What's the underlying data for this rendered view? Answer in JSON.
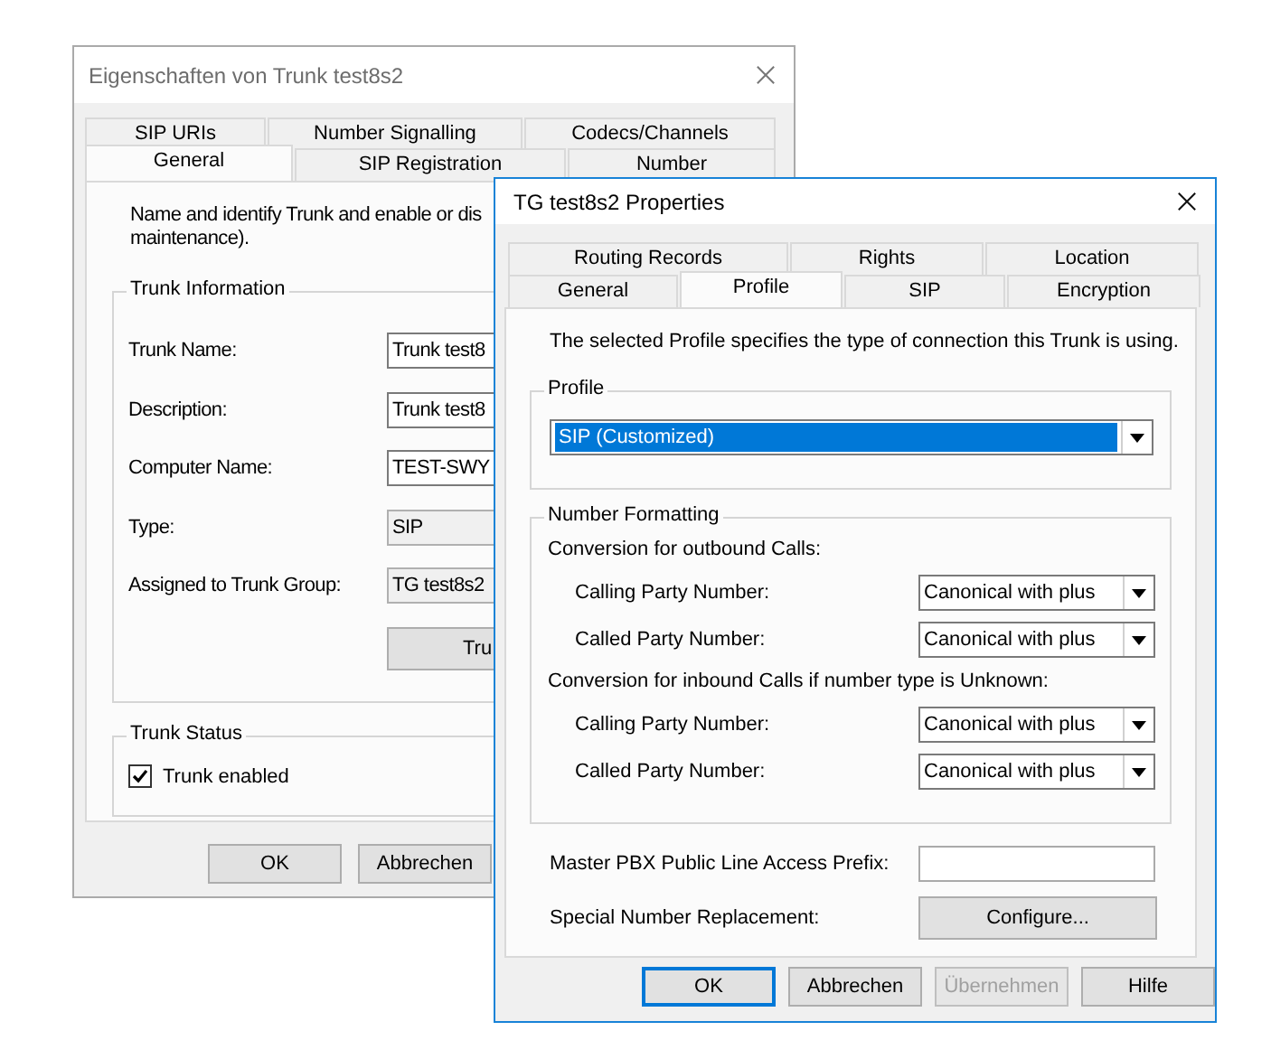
{
  "back_window": {
    "title": "Eigenschaften von Trunk test8s2",
    "tab_rows": [
      [
        {
          "label": "SIP URIs",
          "selected": false
        },
        {
          "label": "Number Signalling",
          "selected": false
        },
        {
          "label": "Codecs/Channels",
          "selected": false
        }
      ],
      [
        {
          "label": "General",
          "selected": true
        },
        {
          "label": "SIP Registration",
          "selected": false
        },
        {
          "label": "Number",
          "selected": false
        }
      ]
    ],
    "description": [
      "Name and identify Trunk and enable or dis",
      "maintenance)."
    ],
    "trunk_information": {
      "title": "Trunk Information",
      "fields": [
        {
          "label": "Trunk Name:",
          "value": "Trunk test8",
          "readonly": false
        },
        {
          "label": "Description:",
          "value": "Trunk test8",
          "readonly": false
        },
        {
          "label": "Computer Name:",
          "value": "TEST-SWY",
          "readonly": false
        },
        {
          "label": "Type:",
          "value": "SIP",
          "readonly": true
        },
        {
          "label": "Assigned to Trunk Group:",
          "value": "TG test8s2",
          "readonly": true
        }
      ],
      "button": "Tru"
    },
    "trunk_status": {
      "title": "Trunk Status",
      "checkbox": {
        "label": "Trunk enabled",
        "checked": true
      }
    },
    "buttons": [
      {
        "label": "OK",
        "disabled": false
      },
      {
        "label": "Abbrechen",
        "disabled": false
      }
    ]
  },
  "front_window": {
    "title": "TG test8s2 Properties",
    "tab_rows": [
      [
        {
          "label": "Routing Records",
          "selected": false
        },
        {
          "label": "Rights",
          "selected": false
        },
        {
          "label": "Location",
          "selected": false
        }
      ],
      [
        {
          "label": "General",
          "selected": false
        },
        {
          "label": "Profile",
          "selected": true
        },
        {
          "label": "SIP",
          "selected": false
        },
        {
          "label": "Encryption",
          "selected": false
        }
      ]
    ],
    "description": "The selected Profile specifies the type of connection this Trunk is using.",
    "profile": {
      "title": "Profile",
      "value": "SIP (Customized)",
      "selected": true
    },
    "number_formatting": {
      "title": "Number Formatting",
      "sections": [
        {
          "heading": "Conversion for outbound Calls:",
          "rows": [
            {
              "label": "Calling Party Number:",
              "value": "Canonical with plus"
            },
            {
              "label": "Called Party Number:",
              "value": "Canonical with plus"
            }
          ]
        },
        {
          "heading": "Conversion for inbound Calls if number type is Unknown:",
          "rows": [
            {
              "label": "Calling Party Number:",
              "value": "Canonical with plus"
            },
            {
              "label": "Called Party Number:",
              "value": "Canonical with plus"
            }
          ]
        }
      ]
    },
    "prefix": {
      "label": "Master PBX Public Line Access Prefix:"
    },
    "replacement": {
      "label": "Special Number Replacement:",
      "button": "Configure..."
    },
    "buttons": [
      {
        "label": "OK",
        "default": true,
        "disabled": false
      },
      {
        "label": "Abbrechen",
        "default": false,
        "disabled": false
      },
      {
        "label": "Übernehmen",
        "default": false,
        "disabled": true
      },
      {
        "label": "Hilfe",
        "default": false,
        "disabled": false
      }
    ]
  }
}
